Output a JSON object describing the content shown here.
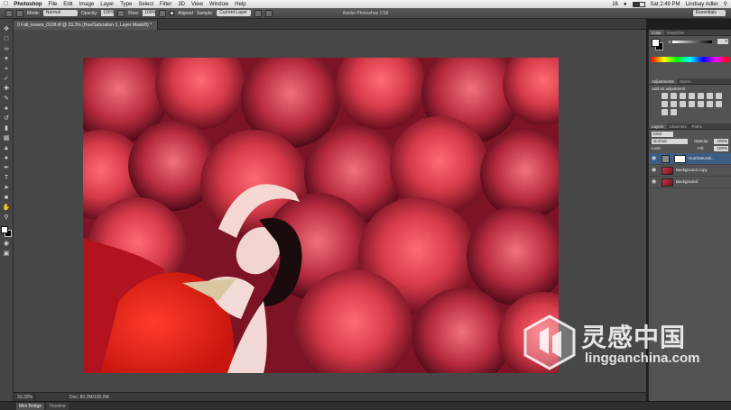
{
  "menubar": {
    "app": "Photoshop",
    "items": [
      "File",
      "Edit",
      "Image",
      "Layer",
      "Type",
      "Select",
      "Filter",
      "3D",
      "View",
      "Window",
      "Help"
    ],
    "status_num": "16",
    "clock": "Sat 2:49 PM",
    "user": "Lindsay Adler",
    "battery_level": 0.6
  },
  "options": {
    "mode_label": "Mode:",
    "mode_value": "Normal",
    "opacity_label": "Opacity:",
    "opacity_value": "100%",
    "flow_label": "Flow:",
    "flow_value": "100%",
    "aligned_label": "Aligned",
    "sample_label": "Sample:",
    "sample_value": "Current Layer",
    "window_title": "Adobe Photoshop CS6",
    "workspace": "Essentials"
  },
  "document": {
    "tab_title": "0 Fall_leaves_0108.tif @ 33.3% (Hue/Saturation 1, Layer Mask/8) *",
    "zoom": "33.33%",
    "doc_size": "Doc: 80.2M/135.9M"
  },
  "bottom_tabs": [
    "Mini Bridge",
    "Timeline"
  ],
  "panels": {
    "color_tabs": [
      "Color",
      "Swatches"
    ],
    "color_channel": "K",
    "color_value": "0",
    "adjust_tabs": [
      "Adjustments",
      "Styles"
    ],
    "adjust_label": "Add an adjustment",
    "layers_tabs": [
      "Layers",
      "Channels",
      "Paths"
    ],
    "kind": "Kind",
    "blend_mode": "Normal",
    "opacity_label": "Opacity:",
    "opacity_value": "100%",
    "lock_label": "Lock:",
    "fill_label": "Fill:",
    "fill_value": "100%",
    "layers": [
      {
        "name": "Hue/Saturati...",
        "selected": true
      },
      {
        "name": "Background copy",
        "selected": false
      },
      {
        "name": "Background",
        "selected": false
      }
    ]
  },
  "watermark": {
    "chinese": "灵感中国",
    "url": "lingganchina.com"
  },
  "colors": {
    "ui_dark": "#454545",
    "panel": "#535353",
    "selection": "#3d5d82",
    "flowers": "#c43a48"
  },
  "icons": [
    "apple-icon",
    "wifi-icon",
    "battery-icon",
    "search-icon",
    "brush-icon",
    "eye-icon",
    "chain-icon"
  ]
}
